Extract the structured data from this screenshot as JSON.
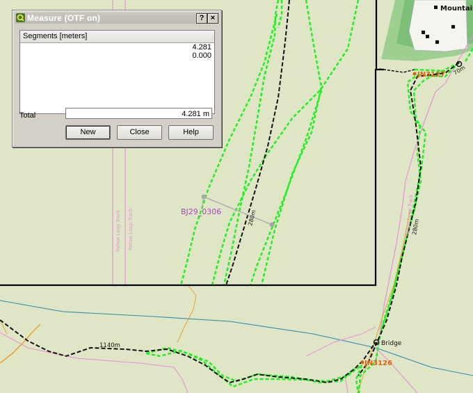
{
  "dialog": {
    "title": "Measure (OTF on)",
    "help_glyph": "?",
    "close_glyph": "×",
    "segments_header": "Segments [meters]",
    "segments": [
      "4.281",
      "0.000"
    ],
    "total_label": "Total",
    "total_value": "4.281 m",
    "buttons": {
      "new": "New",
      "close": "Close",
      "help": "Help"
    }
  },
  "map": {
    "labels": {
      "bj29": "BJ29_0306",
      "mountain": "Mountain",
      "bridge": "Bridge",
      "jn3126": "JN3126",
      "top_code": "JN3127",
      "dist_280_a": "280m",
      "dist_280_b": "280m",
      "dist_70": "70m",
      "dist_1140": "1140m",
      "track_1": "Pahoa Loop Track",
      "track_2": "Pahoa Loop Track",
      "track_3": "Pahoa Loop Track"
    },
    "colors": {
      "background": "#dfe6c6",
      "track_green": "#22ee22",
      "route_black": "#111111",
      "pink_line": "#e98fd8",
      "orange_line": "#e8a030",
      "blue_line": "#2a8ab0",
      "label_purple": "#b040d0",
      "label_orange": "#e06010"
    }
  }
}
